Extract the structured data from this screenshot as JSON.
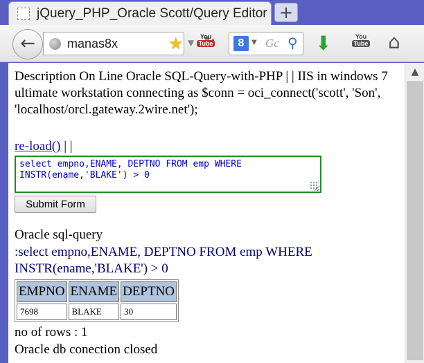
{
  "tab": {
    "title": "jQuery_PHP_Oracle Scott/Query Editor",
    "new_tab_label": "+",
    "favicon": "blank-page-icon"
  },
  "toolbar": {
    "back_icon": "back-arrow-icon",
    "url": "manas8x",
    "search_placeholder": "Gc",
    "search_engine": "google-icon",
    "youtube_top": "You",
    "youtube_bottom": "Tube"
  },
  "page": {
    "description": "Description On Line Oracle SQL-Query-with-PHP | | IIS in windows 7 ultimate workstation connecting as $conn = oci_connect('scott', 'Son', 'localhost/orcl.gateway.2wire.net');",
    "reload_link": "re-load()",
    "reload_suffix": "| |",
    "sql_input": "select empno,ENAME, DEPTNO FROM emp WHERE\nINSTR(ename,'BLAKE') > 0",
    "submit_label": "Submit Form",
    "result_title": "Oracle sql-query",
    "result_query": ":select empno,ENAME, DEPTNO FROM emp WHERE INSTR(ename,'BLAKE') > 0",
    "table": {
      "headers": [
        "EMPNO",
        "ENAME",
        "DEPTNO"
      ],
      "rows": [
        [
          "7698",
          "BLAKE",
          "30"
        ]
      ]
    },
    "row_count": "no of rows : 1",
    "closed_msg": "Oracle db conection closed"
  },
  "colors": {
    "link": "#1a0dab",
    "query_text": "#000080",
    "header_bg": "#b0c4de",
    "textarea_border": "#228b22"
  }
}
